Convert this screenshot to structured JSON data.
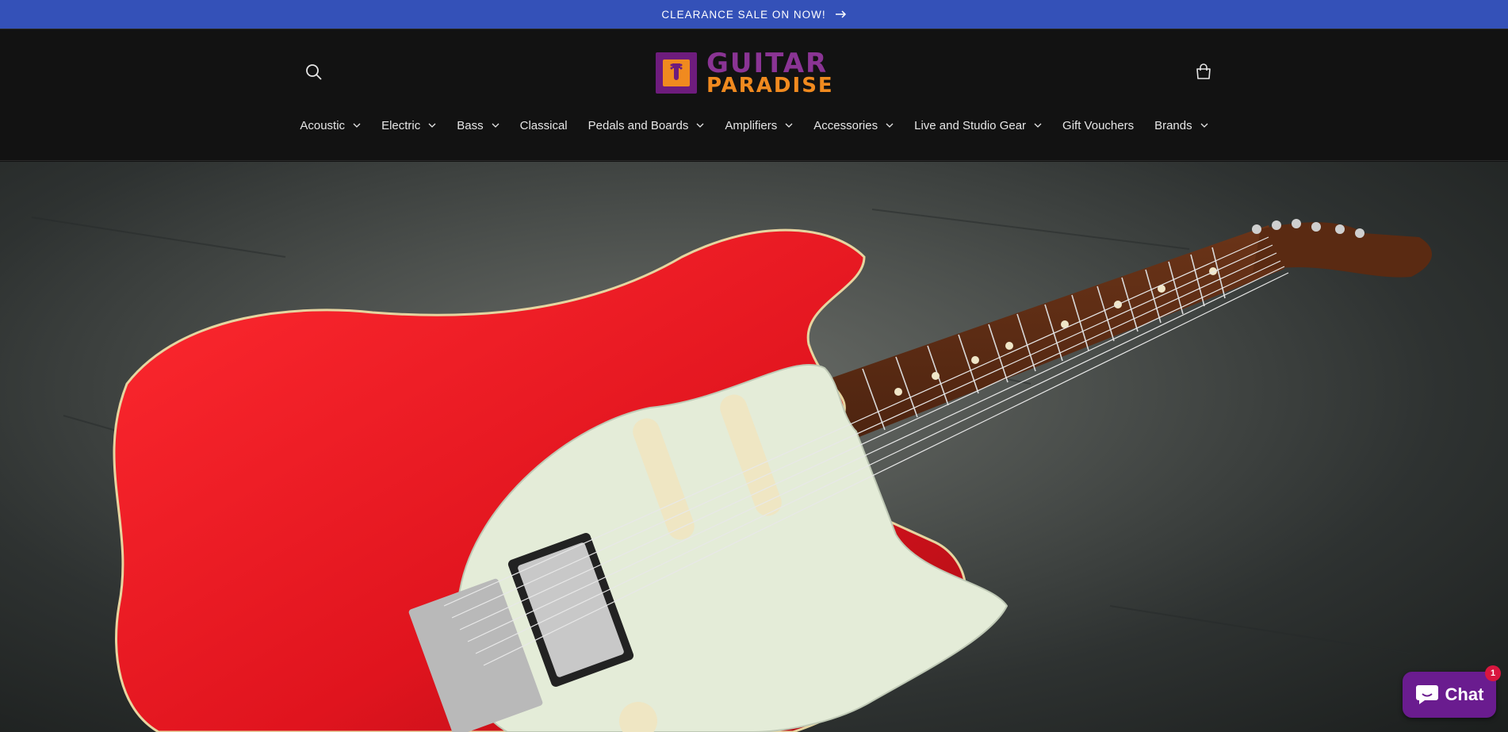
{
  "announcement": {
    "text": "CLEARANCE SALE ON NOW!"
  },
  "header": {
    "logo": {
      "line1": "GUITAR",
      "line2": "PARADISE"
    },
    "nav": [
      {
        "label": "Acoustic",
        "has_dropdown": true
      },
      {
        "label": "Electric",
        "has_dropdown": true
      },
      {
        "label": "Bass",
        "has_dropdown": true
      },
      {
        "label": "Classical",
        "has_dropdown": false
      },
      {
        "label": "Pedals and Boards",
        "has_dropdown": true
      },
      {
        "label": "Amplifiers",
        "has_dropdown": true
      },
      {
        "label": "Accessories",
        "has_dropdown": true
      },
      {
        "label": "Live and Studio Gear",
        "has_dropdown": true
      },
      {
        "label": "Gift Vouchers",
        "has_dropdown": false
      },
      {
        "label": "Brands",
        "has_dropdown": true
      }
    ],
    "icons": {
      "search": "search-icon",
      "cart": "cart-icon"
    }
  },
  "chat": {
    "label": "Chat",
    "badge": "1"
  },
  "colors": {
    "announcement_bg": "#3451b8",
    "header_bg": "#121212",
    "logo_purple": "#8a3494",
    "logo_orange": "#f08a1f",
    "chat_bg": "#6a1c8f",
    "badge_red": "#d9163f",
    "guitar_body": "#e0141e"
  }
}
